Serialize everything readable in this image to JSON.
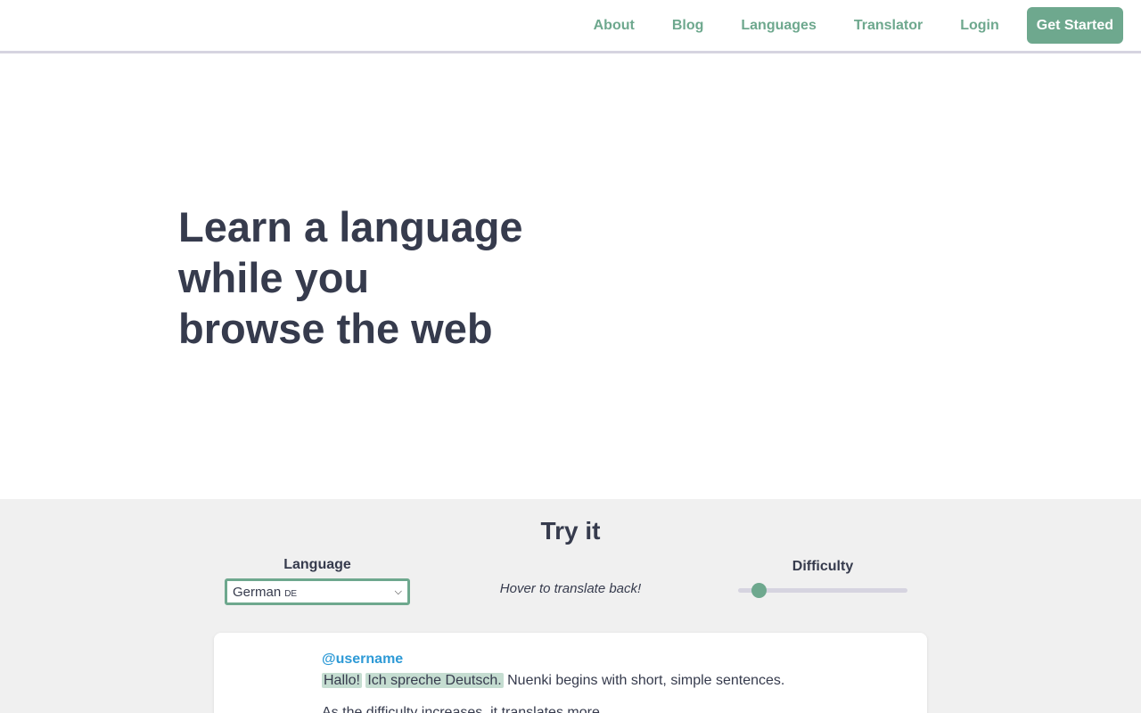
{
  "nav": {
    "links": [
      "About",
      "Blog",
      "Languages",
      "Translator",
      "Login"
    ],
    "cta": "Get Started"
  },
  "hero": {
    "title_lines": [
      "Learn a language",
      "while you",
      "browse the web"
    ]
  },
  "try_it": {
    "title": "Try it",
    "language_label": "Language",
    "language_value": "German",
    "language_code": "DE",
    "hint": "Hover to translate back!",
    "difficulty_label": "Difficulty",
    "difficulty_value": 0.12
  },
  "demo": {
    "username": "@username",
    "highlight_1": "Hallo!",
    "highlight_2": "Ich spreche Deutsch.",
    "plain_1": "Nuenki begins with short, simple sentences.",
    "line_2": "As the difficulty increases, it translates more."
  },
  "colors": {
    "accent": "#6ea88e",
    "text": "#363b4d",
    "link_blue": "#2e9ad6",
    "highlight": "#c5ddd1",
    "section_bg": "#f0f0f0"
  }
}
